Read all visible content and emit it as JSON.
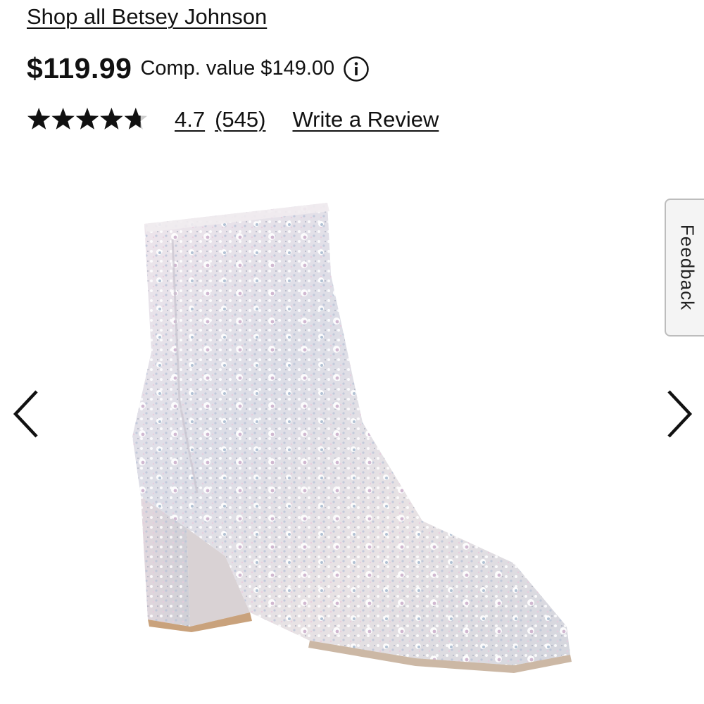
{
  "brand": {
    "link_label": "Shop all Betsey Johnson"
  },
  "pricing": {
    "price": "$119.99",
    "comp_value": "Comp. value $149.00",
    "info_icon": "info-circle-icon"
  },
  "rating": {
    "stars_value": 4.7,
    "stars_max": 5,
    "value_label": "4.7",
    "count_label": "(545)",
    "write_review_label": "Write a Review",
    "star_color": "#111111",
    "star_empty_color": "#cccccc"
  },
  "product_image": {
    "icon": "rhinestone-ankle-boot-image"
  },
  "carousel": {
    "prev_icon": "chevron-left-icon",
    "next_icon": "chevron-right-icon"
  },
  "feedback": {
    "label": "Feedback"
  }
}
